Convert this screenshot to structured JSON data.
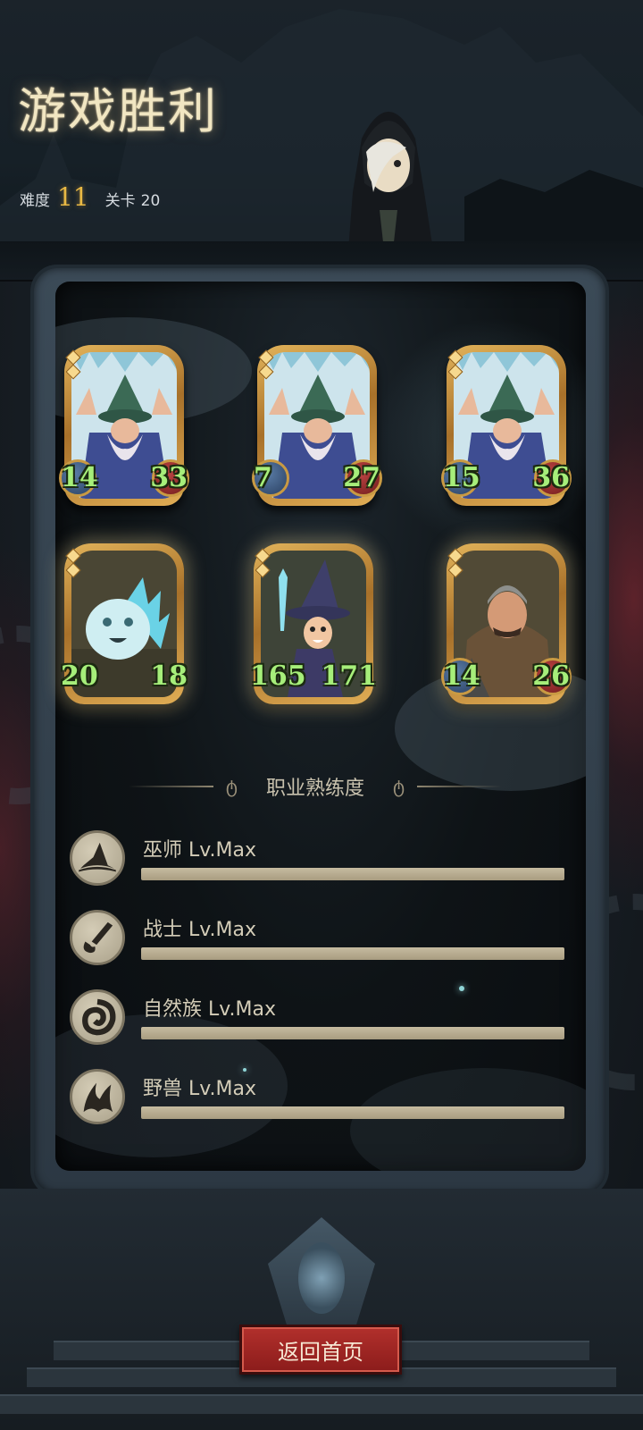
{
  "header": {
    "title": "游戏胜利",
    "difficulty_label": "难度",
    "difficulty_value": "11",
    "level_label": "关卡",
    "level_value": "20"
  },
  "cards": [
    {
      "name": "wizard",
      "attack": "14",
      "health": "33",
      "glow": false
    },
    {
      "name": "wizard",
      "attack": "7",
      "health": "27",
      "glow": false
    },
    {
      "name": "wizard",
      "attack": "15",
      "health": "36",
      "glow": false
    },
    {
      "name": "crystal-spirit",
      "attack": "20",
      "health": "18",
      "glow": true
    },
    {
      "name": "mage",
      "attack": "165",
      "health": "171",
      "glow": true
    },
    {
      "name": "warrior",
      "attack": "14",
      "health": "26",
      "glow": true
    }
  ],
  "proficiency": {
    "title": "职业熟练度",
    "items": [
      {
        "label": "巫师 Lv.Max",
        "icon": "wizard-hat-icon",
        "progress": 1.0
      },
      {
        "label": "战士 Lv.Max",
        "icon": "sword-swirl-icon",
        "progress": 1.0
      },
      {
        "label": "自然族 Lv.Max",
        "icon": "nature-spiral-icon",
        "progress": 1.0
      },
      {
        "label": "野兽 Lv.Max",
        "icon": "beast-claw-icon",
        "progress": 1.0
      }
    ]
  },
  "footer": {
    "home_button": "返回首页"
  },
  "colors": {
    "title": "#f1e6c2",
    "difficulty": "#e9b944",
    "stat_number": "#a6ee7a",
    "button_red": "#b2302c"
  }
}
